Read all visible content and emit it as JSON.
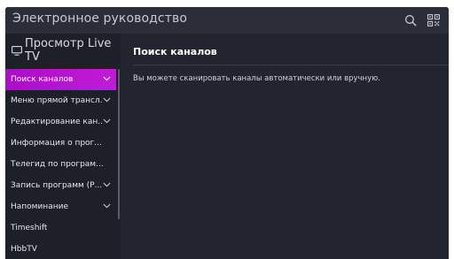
{
  "header": {
    "title": "Электронное руководство",
    "search_icon": "search-icon",
    "qr_icon": "qr-code-icon"
  },
  "sidebar": {
    "title": "Просмотр Live TV",
    "icon": "tv-icon",
    "items": [
      {
        "label": "Поиск каналов",
        "active": true,
        "expandable": true
      },
      {
        "label": "Меню прямой трансл...",
        "active": false,
        "expandable": true
      },
      {
        "label": "Редактирование кан...",
        "active": false,
        "expandable": true
      },
      {
        "label": "Информация о прог...",
        "active": false,
        "expandable": false
      },
      {
        "label": "Телегид по програм...",
        "active": false,
        "expandable": false
      },
      {
        "label": "Запись программ (Р...",
        "active": false,
        "expandable": true
      },
      {
        "label": "Напоминание",
        "active": false,
        "expandable": true
      },
      {
        "label": "Timeshift",
        "active": false,
        "expandable": false
      },
      {
        "label": "HbbTV",
        "active": false,
        "expandable": false
      }
    ]
  },
  "content": {
    "title": "Поиск каналов",
    "description": "Вы можете сканировать каналы автоматически или вручную."
  },
  "colors": {
    "accent": "#b514cc",
    "background": "#222530",
    "topbar": "#2b2e39",
    "sidebar": "#1d2029"
  }
}
